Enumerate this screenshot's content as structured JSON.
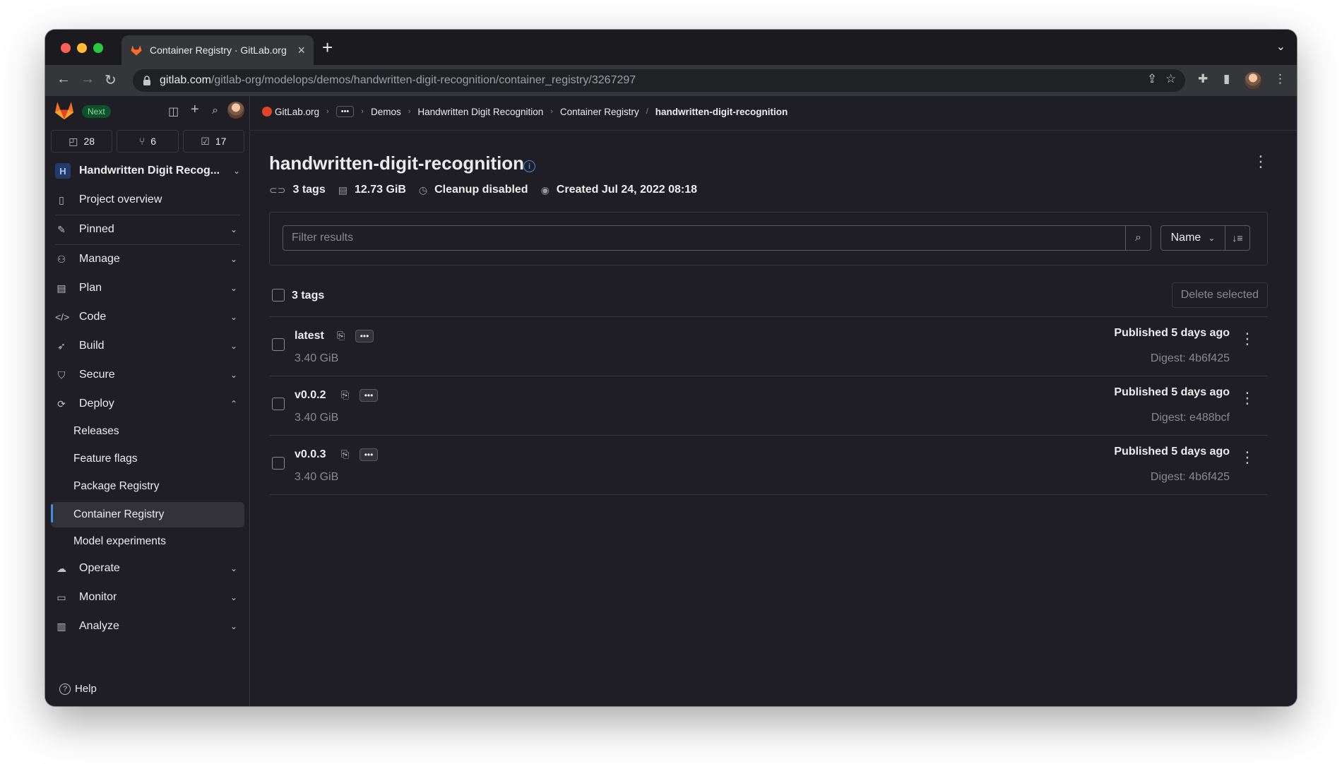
{
  "browser": {
    "tab_title": "Container Registry · GitLab.org",
    "url_host": "gitlab.com",
    "url_path": "/gitlab-org/modelops/demos/handwritten-digit-recognition/container_registry/3267297"
  },
  "sidebar": {
    "badge": "Next",
    "counters": [
      {
        "icon": "issues-icon",
        "value": "28"
      },
      {
        "icon": "merge-request-icon",
        "value": "6"
      },
      {
        "icon": "todo-icon",
        "value": "17"
      }
    ],
    "project": {
      "avatar_letter": "H",
      "name": "Handwritten Digit Recog..."
    },
    "items": [
      {
        "label": "Project overview",
        "icon": "project-icon"
      },
      {
        "label": "Pinned",
        "icon": "pin-icon"
      },
      {
        "label": "Manage",
        "icon": "users-icon"
      },
      {
        "label": "Plan",
        "icon": "calendar-icon"
      },
      {
        "label": "Code",
        "icon": "code-icon"
      },
      {
        "label": "Build",
        "icon": "rocket-icon"
      },
      {
        "label": "Secure",
        "icon": "shield-icon"
      },
      {
        "label": "Deploy",
        "icon": "deploy-icon"
      },
      {
        "label": "Operate",
        "icon": "cloud-gear-icon"
      },
      {
        "label": "Monitor",
        "icon": "monitor-icon"
      },
      {
        "label": "Analyze",
        "icon": "chart-icon"
      }
    ],
    "deploy_sub": [
      {
        "label": "Releases"
      },
      {
        "label": "Feature flags"
      },
      {
        "label": "Package Registry"
      },
      {
        "label": "Container Registry"
      },
      {
        "label": "Model experiments"
      }
    ],
    "help": "Help"
  },
  "breadcrumb": {
    "org": "GitLab.org",
    "dots": "•••",
    "demos": "Demos",
    "project": "Handwritten Digit Recognition",
    "registry": "Container Registry",
    "current": "handwritten-digit-recognition"
  },
  "header": {
    "title": "handwritten-digit-recognition",
    "tags": "3 tags",
    "size": "12.73 GiB",
    "cleanup": "Cleanup disabled",
    "created": "Created Jul 24, 2022 08:18"
  },
  "filter": {
    "placeholder": "Filter results",
    "sort_label": "Name"
  },
  "list": {
    "count_label": "3 tags",
    "delete_label": "Delete selected",
    "rows": [
      {
        "name": "latest",
        "size": "3.40 GiB",
        "published": "Published 5 days ago",
        "digest": "Digest: 4b6f425"
      },
      {
        "name": "v0.0.2",
        "size": "3.40 GiB",
        "published": "Published 5 days ago",
        "digest": "Digest: e488bcf"
      },
      {
        "name": "v0.0.3",
        "size": "3.40 GiB",
        "published": "Published 5 days ago",
        "digest": "Digest: 4b6f425"
      }
    ]
  }
}
